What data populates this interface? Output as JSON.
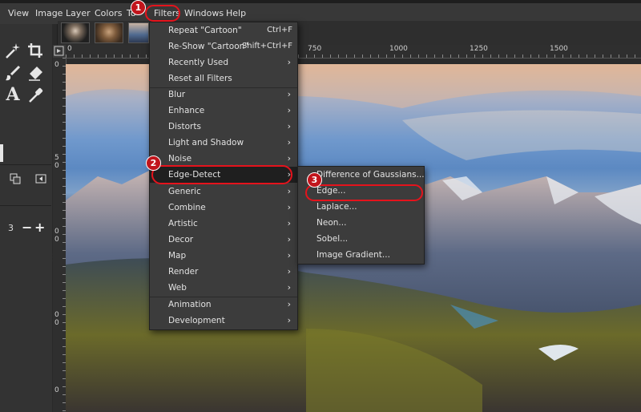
{
  "menubar": {
    "items": [
      {
        "label": "View"
      },
      {
        "label": "Image"
      },
      {
        "label": "Layer"
      },
      {
        "label": "Colors"
      },
      {
        "label": "To"
      },
      {
        "label": "Filters"
      },
      {
        "label": "Windows"
      },
      {
        "label": "Help"
      }
    ]
  },
  "toolbox": {
    "stepper_value": "3",
    "icons": [
      "fuzzy-select-icon",
      "crop-icon",
      "paintbrush-icon",
      "eraser-icon",
      "text-tool-icon",
      "color-picker-icon"
    ]
  },
  "rulers": {
    "h_labels": [
      "0",
      "750",
      "1000",
      "1250",
      "1500"
    ],
    "v_labels": [
      "0",
      "5",
      "0",
      "0",
      "0",
      "0",
      "0",
      "0"
    ]
  },
  "filters_menu": {
    "items": [
      {
        "label": "Repeat \"Cartoon\"",
        "shortcut": "Ctrl+F"
      },
      {
        "label": "Re-Show \"Cartoon\"",
        "shortcut": "Shift+Ctrl+F"
      },
      {
        "label": "Recently Used",
        "submenu": true
      },
      {
        "label": "Reset all Filters"
      },
      {
        "label": "Blur",
        "submenu": true
      },
      {
        "label": "Enhance",
        "submenu": true
      },
      {
        "label": "Distorts",
        "submenu": true
      },
      {
        "label": "Light and Shadow",
        "submenu": true
      },
      {
        "label": "Noise",
        "submenu": true
      },
      {
        "label": "Edge-Detect",
        "submenu": true
      },
      {
        "label": "Generic",
        "submenu": true
      },
      {
        "label": "Combine",
        "submenu": true
      },
      {
        "label": "Artistic",
        "submenu": true
      },
      {
        "label": "Decor",
        "submenu": true
      },
      {
        "label": "Map",
        "submenu": true
      },
      {
        "label": "Render",
        "submenu": true
      },
      {
        "label": "Web",
        "submenu": true
      },
      {
        "label": "Animation",
        "submenu": true
      },
      {
        "label": "Development",
        "submenu": true
      }
    ]
  },
  "edge_submenu": {
    "items": [
      {
        "label": "Difference of Gaussians..."
      },
      {
        "label": "Edge..."
      },
      {
        "label": "Laplace..."
      },
      {
        "label": "Neon..."
      },
      {
        "label": "Sobel..."
      },
      {
        "label": "Image Gradient..."
      }
    ]
  },
  "badges": [
    "1",
    "2",
    "3"
  ],
  "colors": {
    "accent": "#e5131c",
    "menu_bg": "#3c3c3c",
    "highlight": "#1f1f1f"
  }
}
